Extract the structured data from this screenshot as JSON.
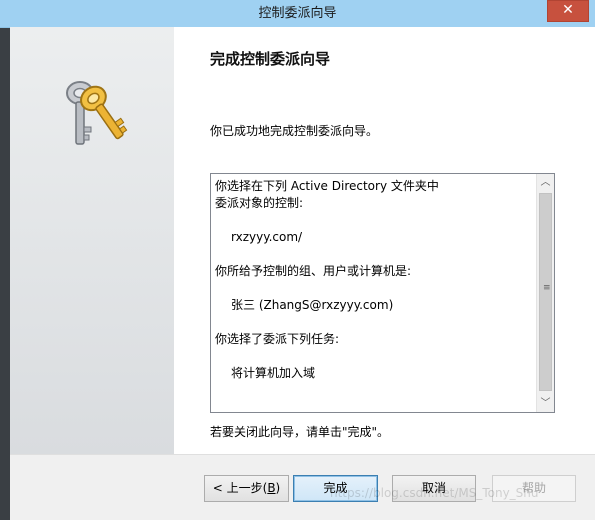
{
  "window": {
    "title": "控制委派向导",
    "close_glyph": "✕"
  },
  "content": {
    "heading": "完成控制委派向导",
    "success_message": "你已成功地完成控制委派向导。",
    "summary": {
      "line1": "你选择在下列 Active Directory 文件夹中",
      "line2": "委派对象的控制:",
      "folder": "rxzyyy.com/",
      "users_label": "你所给予控制的组、用户或计算机是:",
      "user": "张三 (ZhangS@rxzyyy.com)",
      "tasks_label": "你选择了委派下列任务:",
      "task": "将计算机加入域"
    },
    "scrollbar": {
      "up_glyph": "︿",
      "down_glyph": "﹀",
      "grip_glyph": "≡"
    },
    "finish_hint": "若要关闭此向导，请单击\"完成\"。"
  },
  "buttons": {
    "back_label": "< 上一步(",
    "back_accel": "B",
    "back_close": ")",
    "finish_label": "完成",
    "cancel_label": "取消",
    "help_label": "帮助"
  },
  "watermark": "https://blog.csdn.net/MS_Tony_Shu",
  "colors": {
    "titlebar": "#9fd1f2",
    "close_button": "#c7513e",
    "window_background": "#f0f0f0",
    "content_background": "#ffffff"
  },
  "icons": {
    "wizard_icon": "keys-icon"
  }
}
